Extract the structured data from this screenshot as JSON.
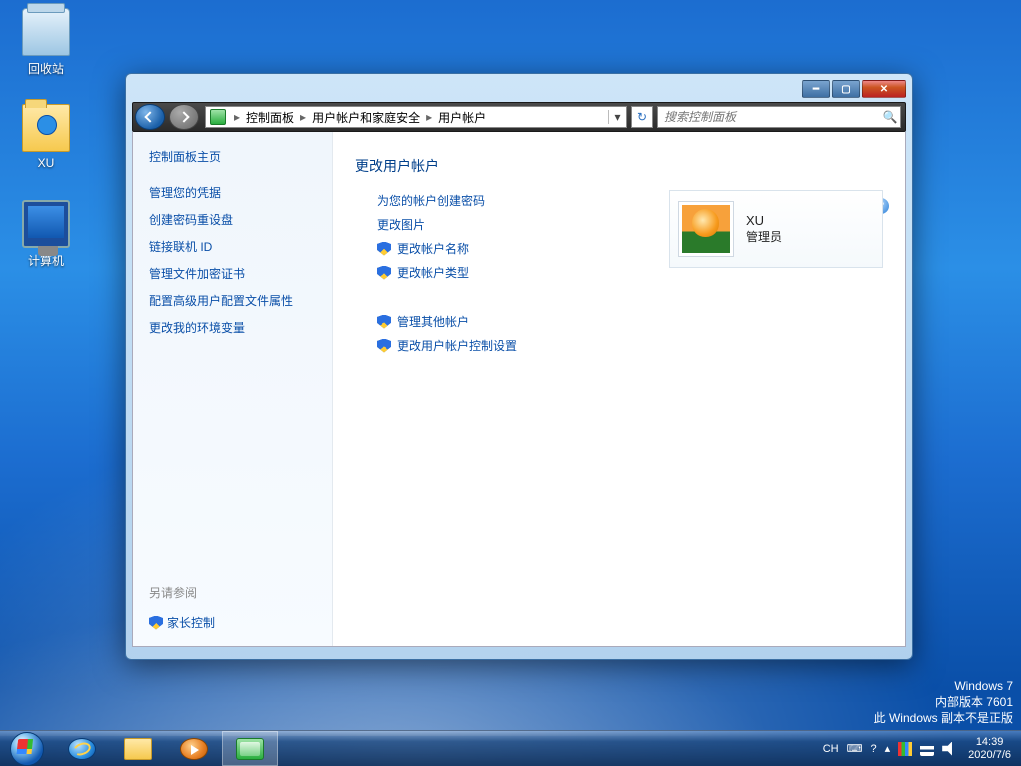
{
  "desktop_icons": {
    "recycle": "回收站",
    "folder": "XU",
    "computer": "计算机"
  },
  "watermark": {
    "l1": "Windows 7",
    "l2": "内部版本 7601",
    "l3": "此 Windows 副本不是正版"
  },
  "tray": {
    "ime": "CH",
    "time": "14:39",
    "date": "2020/7/6"
  },
  "window": {
    "breadcrumb": {
      "root": "控制面板",
      "mid": "用户帐户和家庭安全",
      "leaf": "用户帐户"
    },
    "search_placeholder": "搜索控制面板",
    "side": {
      "home": "控制面板主页",
      "links": [
        "管理您的凭据",
        "创建密码重设盘",
        "链接联机 ID",
        "管理文件加密证书",
        "配置高级用户配置文件属性",
        "更改我的环境变量"
      ],
      "seealso": "另请参阅",
      "parental": "家长控制"
    },
    "main": {
      "heading": "更改用户帐户",
      "plain_links": [
        "为您的帐户创建密码",
        "更改图片"
      ],
      "shield_links_a": [
        "更改帐户名称",
        "更改帐户类型"
      ],
      "shield_links_b": [
        "管理其他帐户",
        "更改用户帐户控制设置"
      ],
      "user": {
        "name": "XU",
        "role": "管理员"
      }
    }
  }
}
